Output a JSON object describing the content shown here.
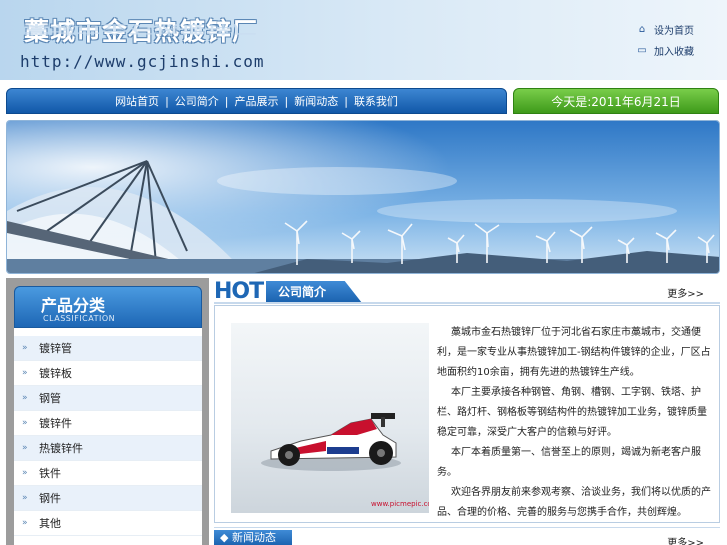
{
  "header": {
    "title": "藁城市金石热镀锌厂",
    "url": "http://www.gcjinshi.com",
    "links": [
      {
        "label": "设为首页",
        "icon": "home-icon"
      },
      {
        "label": "加入收藏",
        "icon": "bookmark-icon"
      }
    ]
  },
  "nav": {
    "items": [
      "网站首页",
      "公司简介",
      "产品展示",
      "新闻动态",
      "联系我们"
    ],
    "date": "今天是:2011年6月21日"
  },
  "sidebar": {
    "title": "产品分类",
    "subtitle": "CLASSIFICATION",
    "items": [
      "镀锌管",
      "镀锌板",
      "钢管",
      "镀锌件",
      "热镀锌件",
      "铁件",
      "钢件",
      "其他"
    ]
  },
  "about": {
    "badge": "HOT",
    "title": "公司简介",
    "more": "更多>>",
    "photo_caption": "www.picmepic.com",
    "paragraphs": [
      "藁城市金石热镀锌厂位于河北省石家庄市藁城市，交通便利，是一家专业从事热镀锌加工-钢结构件镀锌的企业，厂区占地面积约10余亩，拥有先进的热镀锌生产线。",
      "本厂主要承接各种钢管、角钢、槽钢、工字钢、铁塔、护栏、路灯杆、钢格板等钢结构件的热镀锌加工业务，镀锌质量稳定可靠，深受广大客户的信赖与好评。",
      "本厂本着质量第一、信誉至上的原则，竭诚为新老客户服务。",
      "欢迎各界朋友前来参观考察、洽谈业务，我们将以优质的产品、合理的价格、完善的服务与您携手合作，共创辉煌。"
    ]
  },
  "news": {
    "title": "新闻动态",
    "more": "更多>>"
  },
  "colors": {
    "nav_blue": "#1e67b5",
    "date_green": "#4ea82a",
    "sidebar_gray": "#9c9c9c"
  }
}
